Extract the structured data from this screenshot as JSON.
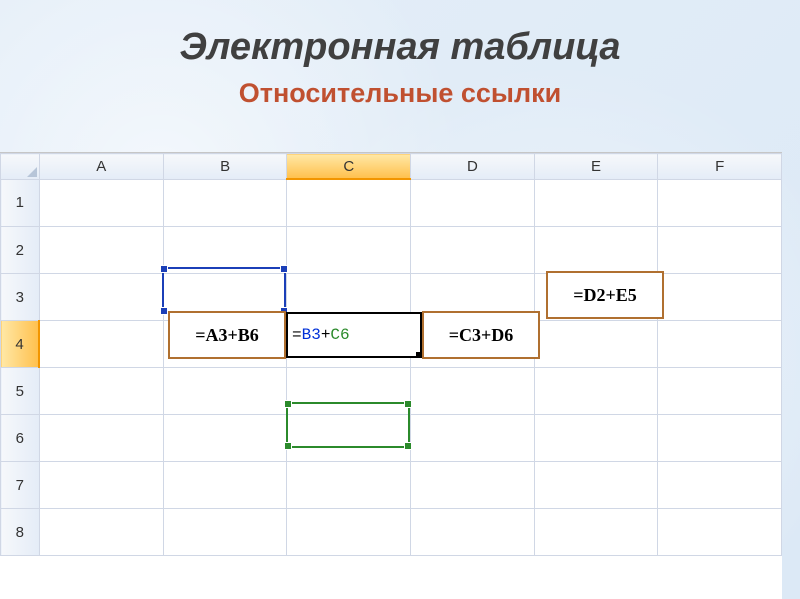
{
  "title": "Электронная таблица",
  "subtitle": "Относительные ссылки",
  "columns": [
    "A",
    "B",
    "C",
    "D",
    "E",
    "F"
  ],
  "active_column": "C",
  "rows": [
    "1",
    "2",
    "3",
    "4",
    "5",
    "6",
    "7",
    "8"
  ],
  "active_row": "4",
  "edit_cell": {
    "prefix": "=",
    "ref1": "B3",
    "plus": "+",
    "ref2": "C6"
  },
  "formula_b4": "=A3+B6",
  "formula_d4": "=C3+D6",
  "formula_e3": "=D2+E5"
}
